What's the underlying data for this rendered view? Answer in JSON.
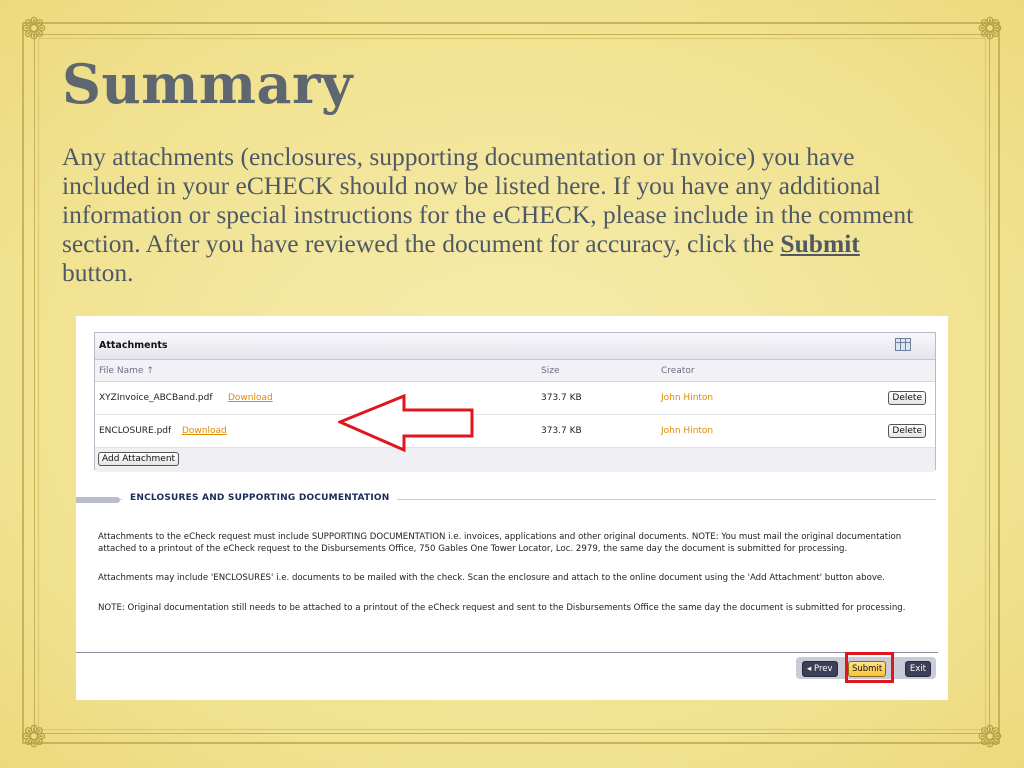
{
  "slide": {
    "title": "Summary",
    "body_before": "Any attachments (enclosures, supporting documentation or Invoice) you have included in your eCHECK should now be listed here. If you have any additional information or special instructions for the eCHECK, please include in the comment section. After you have reviewed the document for accuracy, click the ",
    "body_emphasis": "Submit",
    "body_after": " button.",
    "colors": {
      "background": "#f3e69a",
      "text": "#4f5966",
      "highlight": "#e0161e"
    }
  },
  "attachments": {
    "title": "Attachments",
    "columns": {
      "file_name": "File Name ↑",
      "size": "Size",
      "creator": "Creator"
    },
    "rows": [
      {
        "file": "XYZInvoice_ABCBand.pdf",
        "download": "Download",
        "size": "373.7 KB",
        "creator": "John Hinton",
        "delete": "Delete"
      },
      {
        "file": "ENCLOSURE.pdf",
        "download": "Download",
        "size": "373.7 KB",
        "creator": "John Hinton",
        "delete": "Delete"
      }
    ],
    "add_button": "Add Attachment"
  },
  "section": {
    "title": "ENCLOSURES AND SUPPORTING DOCUMENTATION",
    "paragraphs": [
      "Attachments to the eCheck request must include SUPPORTING DOCUMENTATION i.e. invoices, applications and other original documents. NOTE: You must mail the original documentation attached to a printout of the eCheck request to the Disbursements Office, 750 Gables One Tower Locator, Loc. 2979, the same day the document is submitted for processing.",
      "Attachments may include 'ENCLOSURES' i.e. documents to be mailed with the check. Scan the enclosure and attach to the online document using the 'Add Attachment' button above.",
      "NOTE: Original documentation still needs to be attached to a printout of the eCheck request and sent to the Disbursements Office the same day the document is submitted for processing."
    ]
  },
  "nav": {
    "prev": "◂ Prev",
    "submit": "Submit",
    "exit": "Exit"
  },
  "icons": [
    "corner-ornament-icon",
    "table-settings-icon",
    "red-arrow-icon"
  ]
}
